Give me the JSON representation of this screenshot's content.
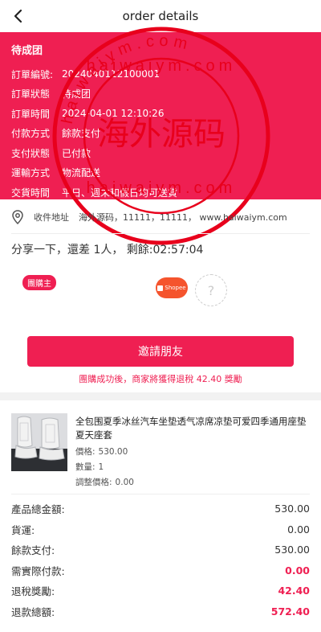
{
  "header": {
    "title": "order details"
  },
  "status": {
    "title": "待成团",
    "rows": [
      {
        "label": "訂單編號:",
        "value": "2024040112100001"
      },
      {
        "label": "訂單狀態",
        "value": "待成团"
      },
      {
        "label": "訂單時間",
        "value": "2024-04-01 12:10:26"
      },
      {
        "label": "付款方式",
        "value": "餘款支付"
      },
      {
        "label": "支付狀態",
        "value": "已付款"
      },
      {
        "label": "運輸方式",
        "value": "物流配送"
      },
      {
        "label": "交貨時間",
        "value": "平日、週末和假日均可送貨"
      }
    ]
  },
  "watermark": {
    "top_text": "haiwaiym.com",
    "center_text": "海外源码",
    "bottom_text": "haiwaiym.com",
    "ring_text": "haiwaiym.com"
  },
  "address": {
    "label": "收件地址",
    "value": "海外源码，11111，11111，    www.haiwaiym.com"
  },
  "share": {
    "text": "分享一下，還差 1人，  剩餘:02:57:04"
  },
  "group": {
    "leader_badge": "團購主",
    "shopee_label": "Shopee",
    "empty_slot": "?"
  },
  "invite": {
    "button_label": "邀請朋友",
    "note": "團購成功後，商家將獲得退稅 42.40 獎勵"
  },
  "product": {
    "name": "全包围夏季冰丝汽车坐垫透气凉席凉垫可爱四季通用座垫夏天座套",
    "price_label": "價格:",
    "price": "530.00",
    "qty_label": "數量:",
    "qty": "1",
    "adjust_label": "調整價格:",
    "adjust": "0.00"
  },
  "totals": [
    {
      "label": "產品總金額:",
      "value": "530.00",
      "highlight": false
    },
    {
      "label": "貨運:",
      "value": "0.00",
      "highlight": false
    },
    {
      "label": "餘款支付:",
      "value": "530.00",
      "highlight": false
    },
    {
      "label": "需實際付款:",
      "value": "0.00",
      "highlight": true
    },
    {
      "label": "退稅獎勵:",
      "value": "42.40",
      "highlight": true
    },
    {
      "label": "退款總額:",
      "value": "572.40",
      "highlight": true
    }
  ],
  "colors": {
    "accent": "#ef1f52",
    "shopee": "#f5542d"
  }
}
